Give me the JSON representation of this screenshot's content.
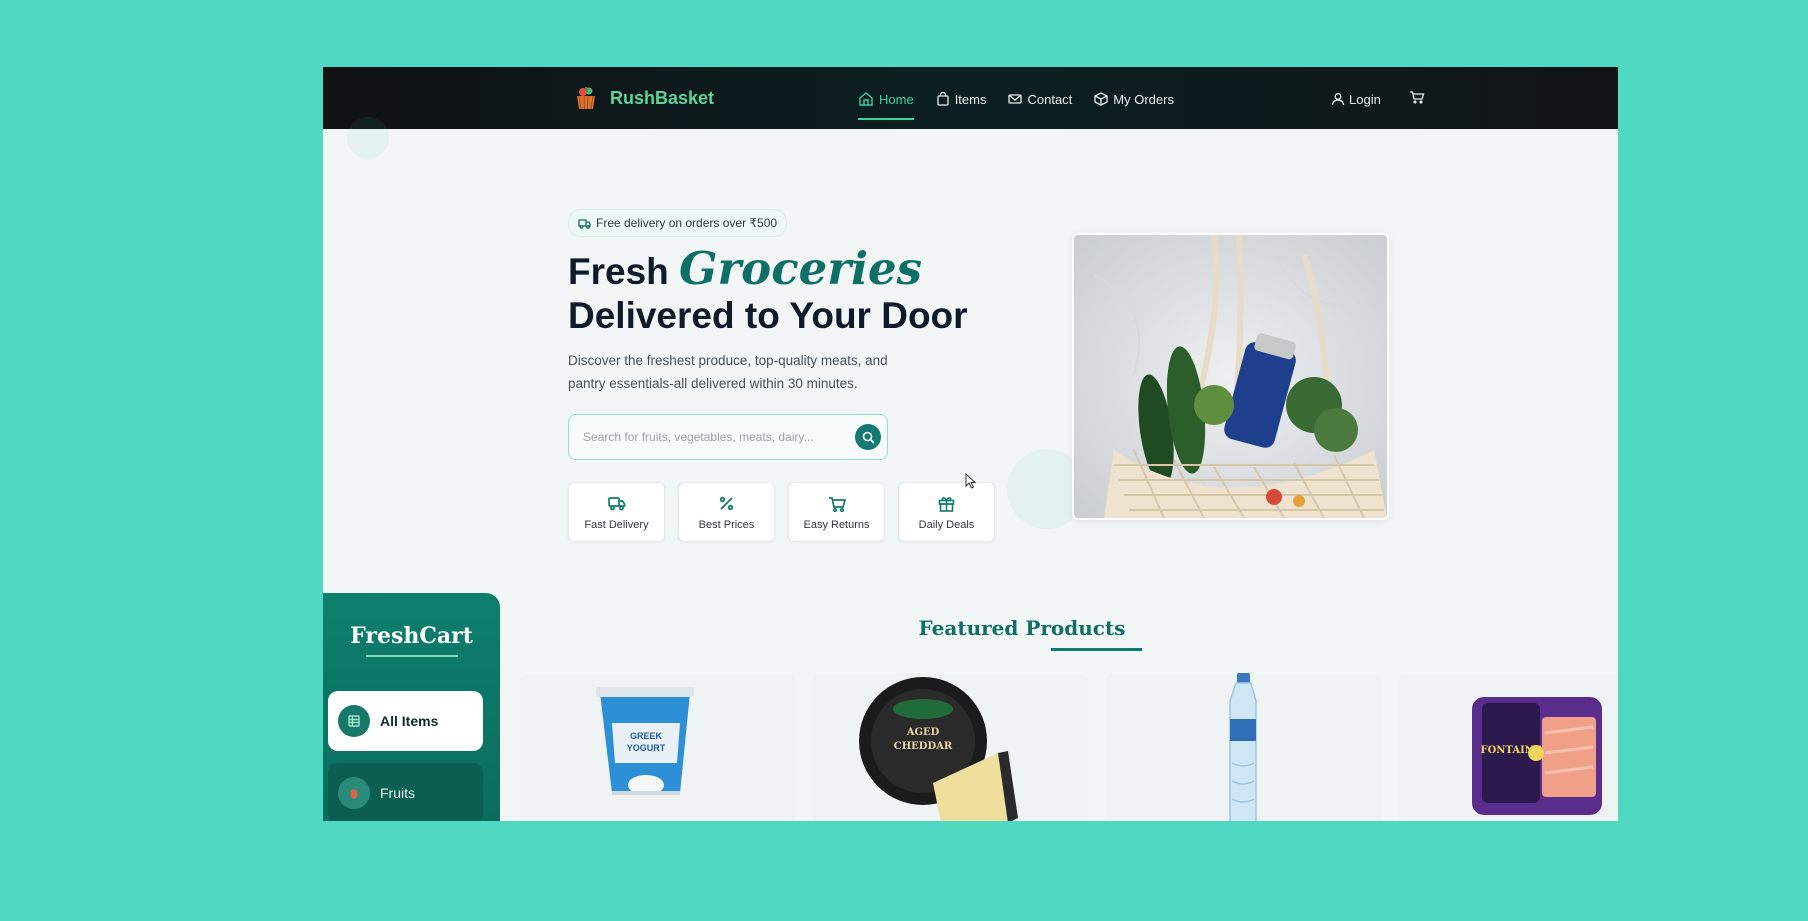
{
  "nav": {
    "brand": "RushBasket",
    "links": [
      {
        "label": "Home",
        "icon": "home-icon",
        "active": true
      },
      {
        "label": "Items",
        "icon": "bag-icon",
        "active": false
      },
      {
        "label": "Contact",
        "icon": "mail-icon",
        "active": false
      },
      {
        "label": "My Orders",
        "icon": "package-icon",
        "active": false
      }
    ],
    "login": "Login",
    "cart_icon": "cart-icon"
  },
  "hero": {
    "badge": "Free delivery on orders over ₹500",
    "title_word1": "Fresh",
    "title_accent": "Groceries",
    "title_line2": "Delivered to Your Door",
    "description": "Discover the freshest produce, top-quality meats, and pantry essentials-all delivered within 30 minutes.",
    "search_placeholder": "Search for fruits, vegetables, meats, dairy..."
  },
  "features": [
    {
      "label": "Fast Delivery",
      "icon": "truck-icon"
    },
    {
      "label": "Best Prices",
      "icon": "percent-icon"
    },
    {
      "label": "Easy Returns",
      "icon": "cart-icon"
    },
    {
      "label": "Daily Deals",
      "icon": "gift-icon"
    }
  ],
  "featured": {
    "title": "Featured Products",
    "products": [
      {
        "name": "GREEK YOGURT"
      },
      {
        "name": "AGED CHEDDAR"
      },
      {
        "name": "Water bottle"
      },
      {
        "name": "FONTAINE"
      }
    ]
  },
  "sidebar": {
    "title": "FreshCart",
    "items": [
      {
        "label": "All Items",
        "active": true
      },
      {
        "label": "Fruits",
        "active": false
      }
    ]
  },
  "colors": {
    "background": "#50d9c2",
    "accent": "#0e6f67",
    "nav_active": "#3ed1a0"
  }
}
